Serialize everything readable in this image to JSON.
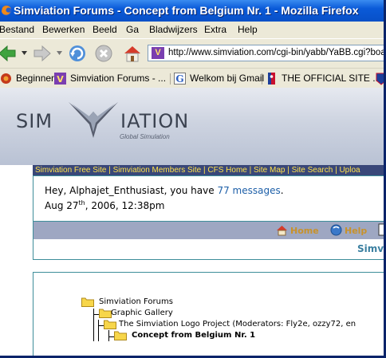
{
  "window": {
    "title": "Simviation Forums - Concept from Belgium Nr. 1 - Mozilla Firefox"
  },
  "menu": [
    "Bestand",
    "Bewerken",
    "Beeld",
    "Ga",
    "Bladwijzers",
    "Extra",
    "Help"
  ],
  "address": {
    "url": "http://www.simviation.com/cgi-bin/yabb/YaBB.cgi?board"
  },
  "bookmarks": [
    {
      "label": "Beginnen",
      "icon": "firefox-icon"
    },
    {
      "label": "Simviation Forums - ...",
      "icon": "simviation-icon"
    },
    {
      "label": "Welkom bij Gmail",
      "icon": "gmail-icon"
    },
    {
      "label": "THE OFFICIAL SITE ...",
      "icon": "nba-icon"
    }
  ],
  "banner": {
    "logo_left": "SIM",
    "logo_right": "IATION",
    "tagline": "Global Simulation"
  },
  "site_links": "Simviation Free Site | Simviation Members Site | CFS Home | Site Map | Site Search | Uploa",
  "user": {
    "greeting_pre": "Hey, Alphajet_Enthusiast, you have ",
    "messages": "77 messages",
    "greeting_post": ".",
    "date_pre": "Aug 27",
    "date_sup": "th",
    "date_post": ", 2006, 12:38pm"
  },
  "toolbar": {
    "home": "Home",
    "help": "Help"
  },
  "subheader": "Simv",
  "breadcrumb": [
    {
      "label": "Simviation Forums",
      "bold": false
    },
    {
      "label": "Graphic Gallery",
      "bold": false
    },
    {
      "label": "The Simviation Logo Project (Moderators: Fly2e, ozzy72, en",
      "bold": false
    },
    {
      "label": "Concept from Belgium Nr. 1",
      "bold": true
    }
  ],
  "colors": {
    "titlebar": "#0a5ad8",
    "links_bar": "#394779",
    "links_text": "#ffe14a",
    "tool_row": "#9ea7c2",
    "accent": "#3e8e9a"
  }
}
